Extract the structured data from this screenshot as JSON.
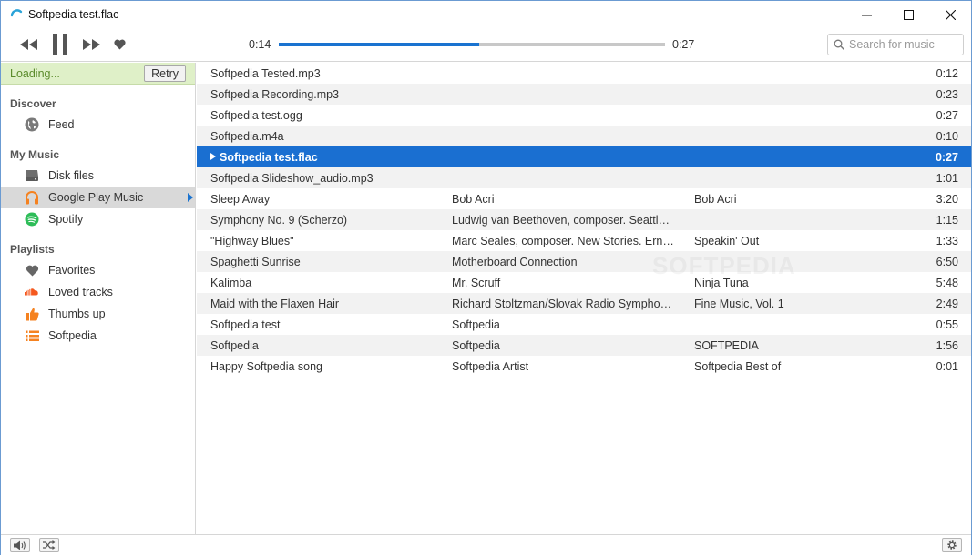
{
  "window": {
    "title": "Softpedia test.flac -"
  },
  "player": {
    "elapsed": "0:14",
    "total": "0:27",
    "progress_fraction": 0.52,
    "accent": "#1a73d0"
  },
  "search": {
    "placeholder": "Search for music"
  },
  "sidebar": {
    "status": "Loading...",
    "retry_label": "Retry",
    "sections": [
      {
        "title": "Discover",
        "items": [
          {
            "label": "Feed",
            "icon": "globe-icon"
          }
        ]
      },
      {
        "title": "My Music",
        "items": [
          {
            "label": "Disk files",
            "icon": "disk-icon"
          },
          {
            "label": "Google Play Music",
            "icon": "headphones-icon",
            "active": true
          },
          {
            "label": "Spotify",
            "icon": "spotify-icon"
          }
        ]
      },
      {
        "title": "Playlists",
        "items": [
          {
            "label": "Favorites",
            "icon": "heart-icon"
          },
          {
            "label": "Loved tracks",
            "icon": "soundcloud-icon"
          },
          {
            "label": "Thumbs up",
            "icon": "thumbs-up-icon"
          },
          {
            "label": "Softpedia",
            "icon": "list-icon"
          }
        ]
      }
    ]
  },
  "tracks": [
    {
      "title": "Softpedia Tested.mp3",
      "artist": "",
      "album": "",
      "duration": "0:12"
    },
    {
      "title": "Softpedia Recording.mp3",
      "artist": "",
      "album": "",
      "duration": "0:23"
    },
    {
      "title": "Softpedia test.ogg",
      "artist": "",
      "album": "",
      "duration": "0:27"
    },
    {
      "title": "Softpedia.m4a",
      "artist": "",
      "album": "",
      "duration": "0:10"
    },
    {
      "title": "Softpedia test.flac",
      "artist": "",
      "album": "",
      "duration": "0:27",
      "playing": true
    },
    {
      "title": "Softpedia Slideshow_audio.mp3",
      "artist": "",
      "album": "",
      "duration": "1:01"
    },
    {
      "title": "Sleep Away",
      "artist": "Bob Acri",
      "album": "Bob Acri",
      "duration": "3:20"
    },
    {
      "title": "Symphony No. 9 (Scherzo)",
      "artist": "Ludwig van Beethoven, composer. Seattle…",
      "album": "",
      "duration": "1:15"
    },
    {
      "title": "\"Highway Blues\"",
      "artist": "Marc Seales, composer. New Stories. Erni…",
      "album": "Speakin' Out",
      "duration": "1:33"
    },
    {
      "title": "Spaghetti Sunrise",
      "artist": "Motherboard Connection",
      "album": "",
      "duration": "6:50"
    },
    {
      "title": "Kalimba",
      "artist": "Mr. Scruff",
      "album": "Ninja Tuna",
      "duration": "5:48"
    },
    {
      "title": "Maid with the Flaxen Hair",
      "artist": "Richard Stoltzman/Slovak Radio Sympho…",
      "album": "Fine Music, Vol. 1",
      "duration": "2:49"
    },
    {
      "title": "Softpedia test",
      "artist": "Softpedia",
      "album": "",
      "duration": "0:55"
    },
    {
      "title": "Softpedia",
      "artist": "Softpedia",
      "album": "SOFTPEDIA",
      "duration": "1:56"
    },
    {
      "title": "Happy Softpedia song",
      "artist": "Softpedia Artist",
      "album": "Softpedia Best of",
      "duration": "0:01"
    }
  ],
  "watermark": "SOFTPEDIA"
}
